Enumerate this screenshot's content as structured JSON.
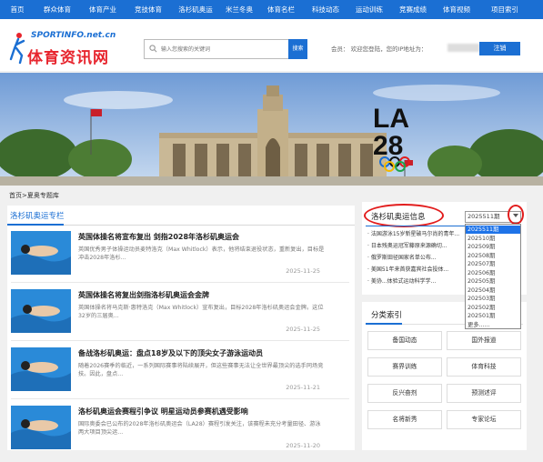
{
  "nav": [
    "首页",
    "群众体育",
    "体育产业",
    "竞技体育",
    "洛杉矶奥运",
    "米兰冬奥",
    "体育名栏",
    "科技动态",
    "运动训练",
    "竞赛成绩",
    "体育视频",
    "项目索引"
  ],
  "logo": {
    "top": "SPORTINFO.net.cn",
    "main": "体育资讯网"
  },
  "search": {
    "placeholder": "输入您搜索的关键词",
    "button": "搜索"
  },
  "member": {
    "text": "会员：          欢迎您登陆，您的IP地址为：",
    "login": "注销"
  },
  "banner": {
    "logo_top": "LA",
    "logo_bottom": "28"
  },
  "breadcrumb": "首页>夏奥专题库",
  "section": {
    "title": "洛杉矶奥运专栏"
  },
  "news": [
    {
      "title": "英国体操名将宣布复出 剑指2028年洛杉矶奥运会",
      "desc": "英国优秀男子体操运动员麦特洛克（Max Whitlock）表示，他将结束退役状态，重新复出，目标是冲击2028年洛杉...",
      "date": "2025-11-25"
    },
    {
      "title": "英国体操名将复出剑指洛杉矶奥运会金牌",
      "desc": "英国体操名将马克斯·惠特洛克（Max Whitlock）宣布复出，目标2028年洛杉矶奥运会金牌。这位32岁的三届奥...",
      "date": "2025-11-25"
    },
    {
      "title": "备战洛杉矶奥运：盘点18岁及以下的顶尖女子游泳运动员",
      "desc": "随着2026赛季的临近，一系列国际赛事将陆续展开，但这些赛事无法让全世界最顶尖的选手同场竞技。因此，盘点...",
      "date": "2025-11-21"
    },
    {
      "title": "洛杉矶奥运会赛程引争议 明星运动员参赛机遇受影响",
      "desc": "国际奥委会已公布的2028年洛杉矶奥运会（LA28）赛程引发关注，该赛程未充分考量田径、游泳两大项目顶尖运...",
      "date": "2025-11-20"
    }
  ],
  "info": {
    "title": "洛杉矶奥运信息",
    "items": [
      "· 法国游泳15岁新星破马尔尚的青年...",
      "· 日本残奥运冠军藤原来源确切...",
      "· 俄罗斯田径国家名单公布...",
      "· 美国51年来首获嘉宾社会投体...",
      "· 美协...体验式运动科学学..."
    ]
  },
  "period_select": {
    "value": "2025511期",
    "options": [
      "2025511期",
      "202510期",
      "202509期",
      "202508期",
      "202507期",
      "202506期",
      "202505期",
      "202504期",
      "202503期",
      "202502期",
      "202501期",
      "更多......"
    ],
    "selected_index": 0
  },
  "categories": {
    "title": "分类索引",
    "items": [
      "备国动态",
      "国外报道",
      "赛界训练",
      "体育科技",
      "反兴奋剂",
      "预测述评",
      "名将新秀",
      "专家论坛"
    ]
  },
  "colors": {
    "brand_blue": "#1b6fd3",
    "highlight_red": "#e21d1d",
    "select_blue": "#1e73e8"
  }
}
